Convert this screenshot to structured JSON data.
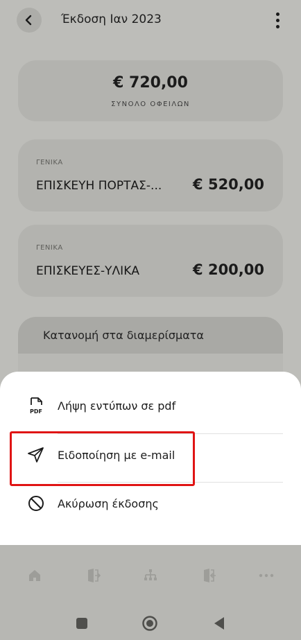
{
  "header": {
    "title": "Έκδοση Ιαν 2023",
    "back_icon": "chevron-left-icon",
    "menu_icon": "kebab-menu-icon"
  },
  "summary": {
    "amount": "€ 720,00",
    "label": "ΣΥΝΟΛΟ ΟΦΕΙΛΩΝ"
  },
  "expenses": [
    {
      "category": "ΓΕΝΙΚΑ",
      "name": "ΕΠΙΣΚΕΥΗ ΠΟΡΤΑΣ-...",
      "amount": "€ 520,00"
    },
    {
      "category": "ΓΕΝΙΚΑ",
      "name": "ΕΠΙΣΚΕΥΕΣ-ΥΛΙΚΑ",
      "amount": "€ 200,00"
    }
  ],
  "distribution": {
    "title": "Κατανομή στα διαμερίσματα"
  },
  "sheet": {
    "items": [
      {
        "label": "Λήψη εντύπων σε pdf",
        "icon": "pdf-file-icon"
      },
      {
        "label": "Ειδοποίηση με e-mail",
        "icon": "send-icon"
      },
      {
        "label": "Ακύρωση έκδοσης",
        "icon": "ban-icon"
      }
    ],
    "highlight_color": "#e01414"
  },
  "bottom_nav": {
    "items": [
      "home-icon",
      "door-enter-icon",
      "org-tree-icon",
      "door-exit-icon",
      "more-icon"
    ]
  },
  "system_nav": {
    "items": [
      "recents-square-icon",
      "home-circle-icon",
      "back-triangle-icon"
    ]
  }
}
